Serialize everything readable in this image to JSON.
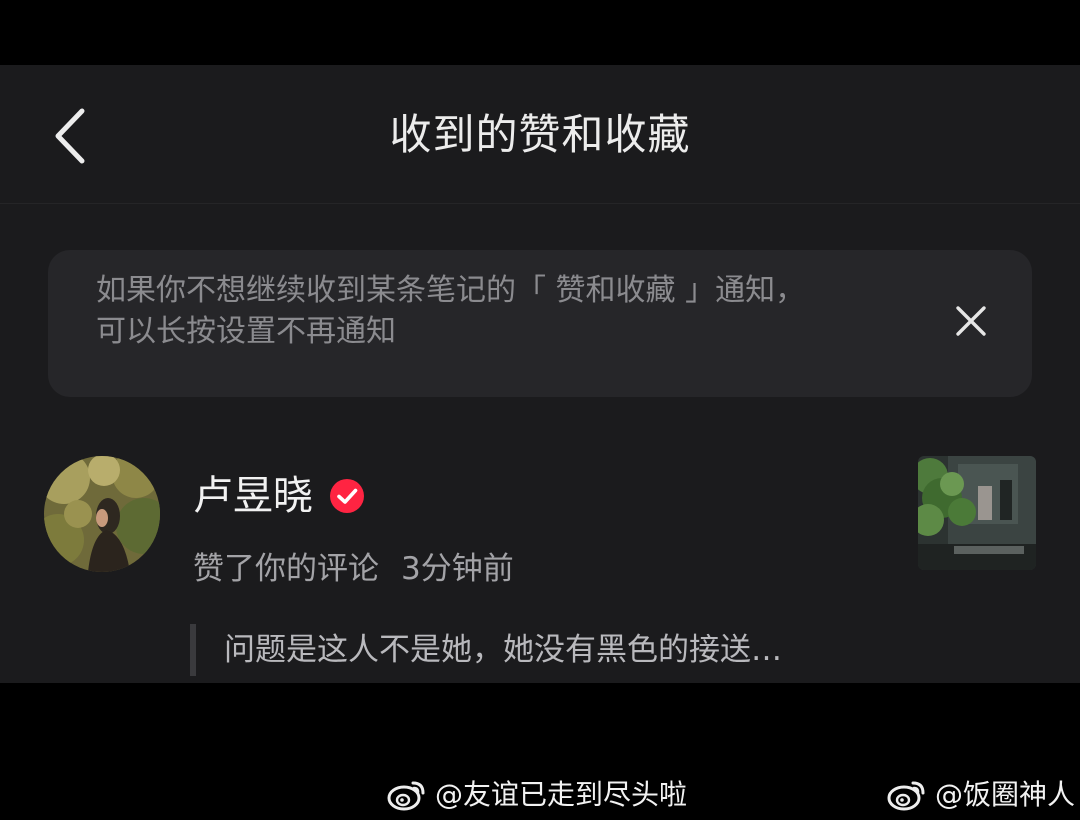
{
  "header": {
    "title": "收到的赞和收藏",
    "back_icon": "chevron-left-icon"
  },
  "notice": {
    "line1": "如果你不想继续收到某条笔记的「 赞和收藏 」通知，",
    "line2": "可以长按设置不再通知",
    "close_icon": "close-icon"
  },
  "notification": {
    "username": "卢昱晓",
    "verified_icon": "verified-badge-icon",
    "action": "赞了你的评论",
    "time": "3分钟前",
    "quote": "问题是这人不是她，她没有黑色的接送…",
    "colors": {
      "verified": "#ff2442"
    }
  },
  "watermarks": [
    {
      "text": "@友谊已走到尽头啦",
      "icon": "weibo-logo-icon"
    },
    {
      "text": "@饭圈神人",
      "icon": "weibo-logo-icon"
    }
  ],
  "colors": {
    "background": "#000000",
    "screen": "#1b1b1d",
    "notice_bg": "#262629"
  }
}
